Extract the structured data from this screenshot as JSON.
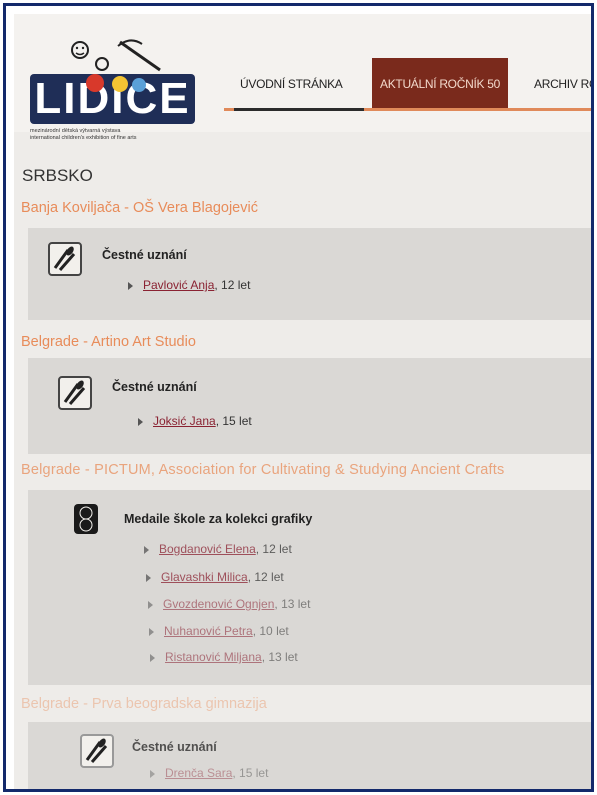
{
  "logo": {
    "word": "LIDICE",
    "subtitle_cz": "mezinárodní dětská výtvarná výstava",
    "subtitle_en": "international children's exhibition of fine arts"
  },
  "nav": {
    "items": [
      {
        "label": "ÚVODNÍ STRÁNKA"
      },
      {
        "label": "AKTUÁLNÍ ROČNÍK 50"
      },
      {
        "label": "ARCHIV RO"
      }
    ]
  },
  "country": "SRBSKO",
  "schools": [
    {
      "name": "Banja Koviljača - OŠ Vera Blagojević",
      "award": "Čestné uznání",
      "entries": [
        {
          "name": "Pavlović Anja",
          "age": ", 12 let"
        }
      ]
    },
    {
      "name": "Belgrade - Artino Art Studio",
      "award": "Čestné uznání",
      "entries": [
        {
          "name": "Joksić Jana",
          "age": ", 15 let"
        }
      ]
    },
    {
      "name": "Belgrade - PICTUM, Association for Cultivating & Studying Ancient Crafts",
      "award": "Medaile školе za kolekci grafiky",
      "entries": [
        {
          "name": "Bogdanović Elena",
          "age": ", 12 let"
        },
        {
          "name": "Glavashki Milica",
          "age": ", 12 let"
        },
        {
          "name": "Gvozdenović Ognjen",
          "age": ", 13 let"
        },
        {
          "name": "Nuhanović Petra",
          "age": ", 10 let"
        },
        {
          "name": "Ristanović Miljana",
          "age": ", 13 let"
        }
      ]
    },
    {
      "name": "Belgrade - Prva beogradska gimnazija",
      "award": "Čestné uznání",
      "entries": [
        {
          "name": "Drenča Sara",
          "age": ", 15 let"
        }
      ]
    }
  ],
  "colors": {
    "frame": "#13296b",
    "nav_active": "#7a2a1c",
    "school_heading": "#e88c5a",
    "link": "#8a2232"
  }
}
